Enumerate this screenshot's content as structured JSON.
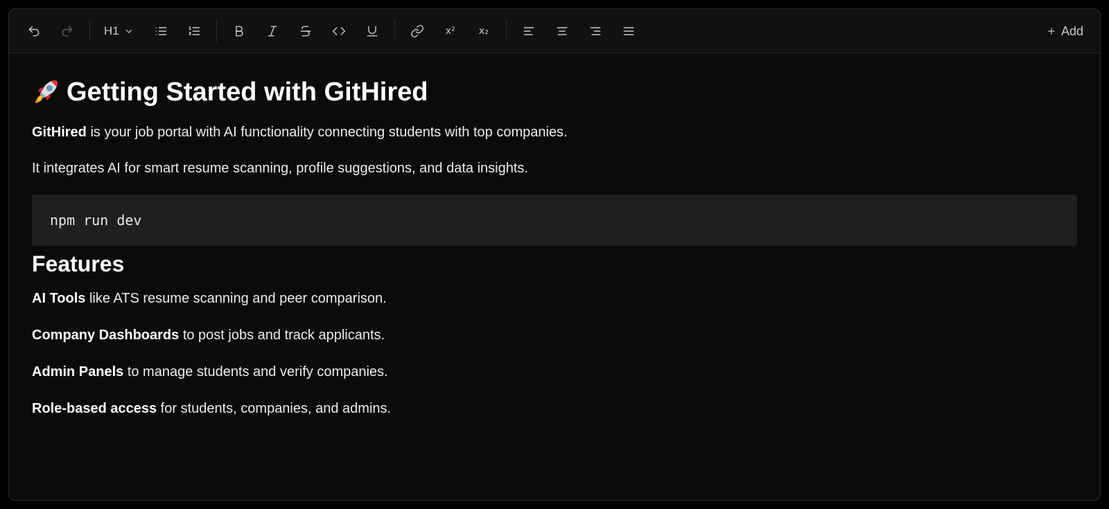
{
  "toolbar": {
    "heading_select": "H1",
    "buttons": [
      {
        "name": "undo-icon"
      },
      {
        "name": "redo-icon"
      },
      {
        "name": "bullet-list-icon"
      },
      {
        "name": "ordered-list-icon"
      },
      {
        "name": "bold-icon"
      },
      {
        "name": "italic-icon"
      },
      {
        "name": "strikethrough-icon"
      },
      {
        "name": "code-icon"
      },
      {
        "name": "underline-icon"
      },
      {
        "name": "link-icon"
      },
      {
        "name": "superscript-icon"
      },
      {
        "name": "subscript-icon"
      },
      {
        "name": "align-left-icon"
      },
      {
        "name": "align-center-icon"
      },
      {
        "name": "align-right-icon"
      },
      {
        "name": "align-justify-icon"
      }
    ],
    "superscript_label": "x²",
    "subscript_label": "x₂",
    "add_label": "Add"
  },
  "document": {
    "title_icon": "rocket-icon",
    "title": "Getting Started with GitHired",
    "intro": {
      "bold": "GitHired",
      "rest": " is your job portal with AI functionality connecting students with top companies."
    },
    "paragraph2": "It integrates AI for smart resume scanning, profile suggestions, and data insights.",
    "code": "npm run dev",
    "features_heading": "Features",
    "features": [
      {
        "bold": "AI Tools",
        "rest": " like ATS resume scanning and peer comparison."
      },
      {
        "bold": "Company Dashboards",
        "rest": " to post jobs and track applicants."
      },
      {
        "bold": "Admin Panels",
        "rest": " to manage students and verify companies."
      },
      {
        "bold": "Role-based access",
        "rest": " for students, companies, and admins."
      }
    ]
  },
  "colors": {
    "background": "#0b0b0b",
    "toolbar": "#111111",
    "code_background": "#1f1f1f",
    "text": "#ffffff"
  }
}
